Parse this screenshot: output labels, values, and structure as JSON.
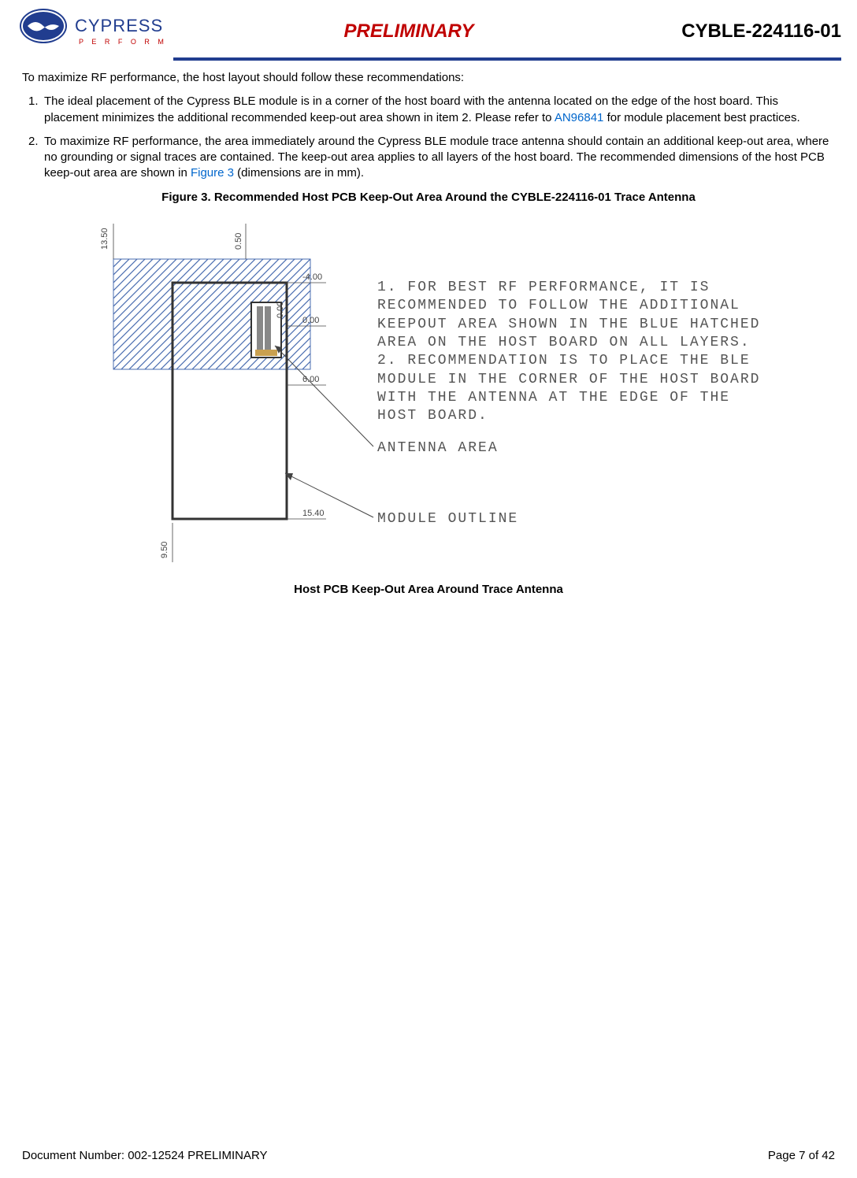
{
  "header": {
    "preliminary": "PRELIMINARY",
    "part_number": "CYBLE-224116-01",
    "logo_text": "CYPRESS",
    "logo_sub": "P  E  R  F  O  R  M"
  },
  "intro": "To maximize RF performance, the host layout should follow these recommendations:",
  "items": [
    {
      "num": "1.",
      "body_pre": "The ideal placement of the Cypress BLE module is in a corner of the host board with the antenna located on the edge of the host board. This placement minimizes the additional recommended keep-out area shown in item 2. Please refer to ",
      "link": "AN96841",
      "body_post": " for module placement best practices."
    },
    {
      "num": "2.",
      "body_pre": "To maximize RF performance, the area immediately around the Cypress BLE module trace antenna should contain an additional keep-out area, where no grounding or signal traces are contained. The keep-out area applies to all layers of the host board. The recommended dimensions of the host PCB keep-out area are shown in ",
      "link": "Figure 3",
      "body_post": " (dimensions are in mm)."
    }
  ],
  "figure": {
    "caption": "Figure 3.  Recommended Host PCB Keep-Out Area Around the CYBLE-224116-01 Trace Antenna",
    "subcaption": "Host PCB Keep-Out Area Around Trace Antenna",
    "note1": "1. FOR BEST RF PERFORMANCE, IT IS RECOMMENDED TO FOLLOW THE ADDITIONAL KEEPOUT AREA SHOWN IN THE BLUE HATCHED AREA ON THE HOST BOARD ON ALL LAYERS.",
    "note2": "2. RECOMMENDATION IS TO PLACE THE BLE MODULE IN THE CORNER OF THE HOST BOARD WITH THE ANTENNA AT THE EDGE OF THE HOST BOARD.",
    "antenna_label": "ANTENNA AREA",
    "module_label": "MODULE OUTLINE",
    "dims": {
      "h_top_left": "13.50",
      "h_top_right": "0.50",
      "h_neg4": "-4.00",
      "v_0a": "0.00",
      "v_0b": "0.00",
      "h_6": "6.00",
      "h_1540": "15.40",
      "h_bottom": "9.50"
    }
  },
  "footer": {
    "docnum": "Document Number: 002-12524 PRELIMINARY",
    "page": "Page 7 of 42"
  }
}
